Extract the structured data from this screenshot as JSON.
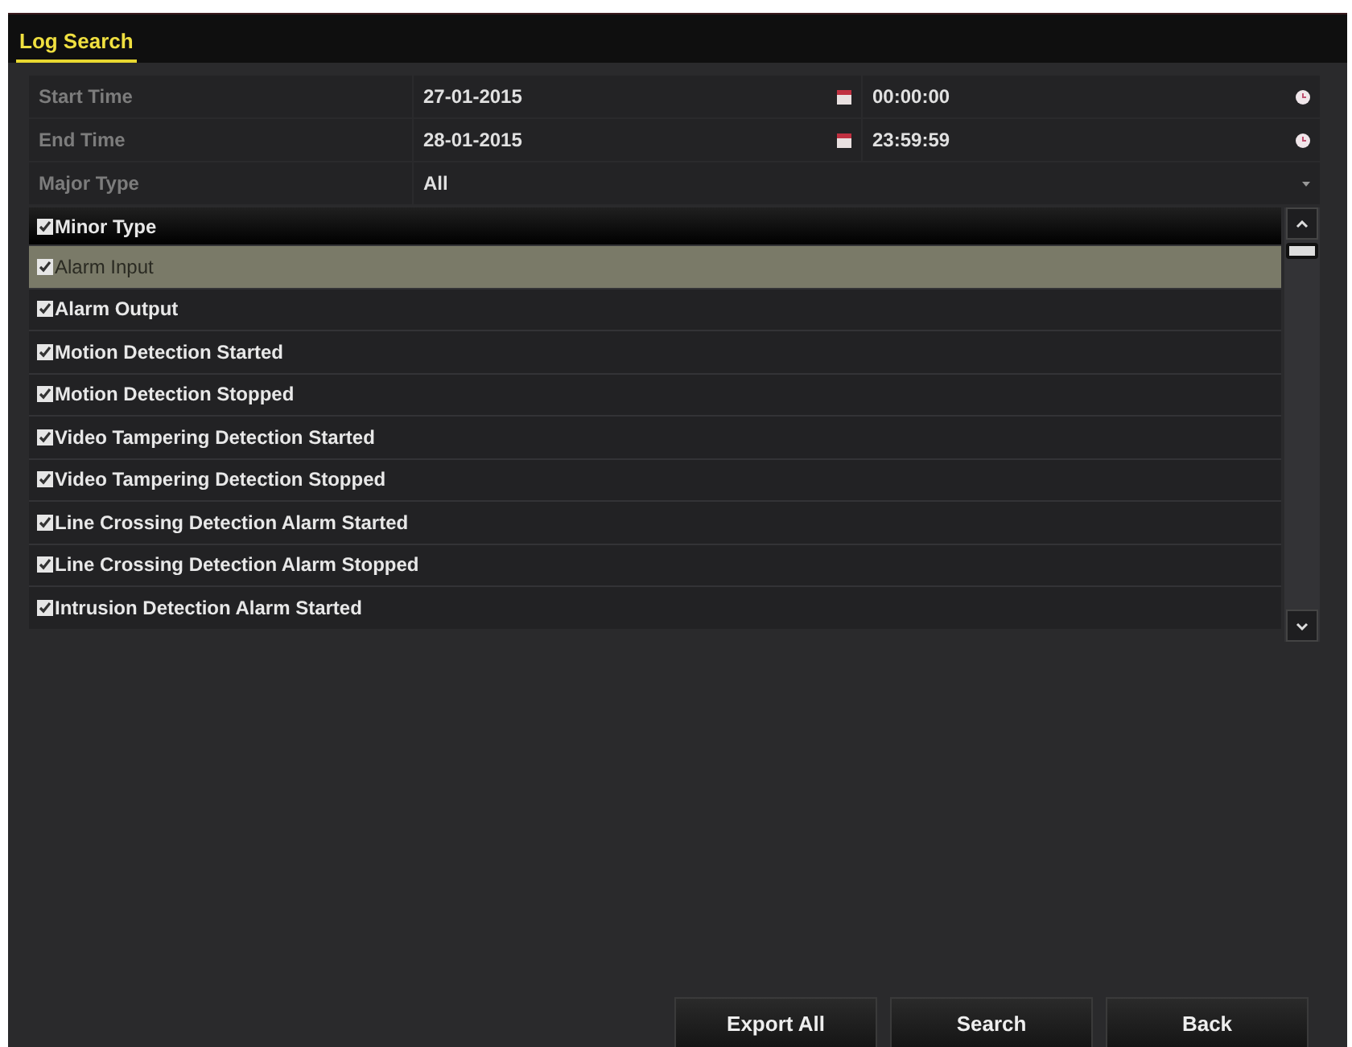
{
  "tabs": [
    {
      "label": "Log Search",
      "selected": true
    }
  ],
  "form": {
    "rows": [
      {
        "kind": "datetime",
        "label": "Start Time",
        "date": "27-01-2015",
        "time": "00:00:00"
      },
      {
        "kind": "datetime",
        "label": "End Time",
        "date": "28-01-2015",
        "time": "23:59:59"
      },
      {
        "kind": "select",
        "label": "Major Type",
        "value": "All"
      }
    ]
  },
  "minor_type": {
    "label": "Minor Type",
    "checked": true,
    "items": [
      {
        "label": "Alarm Input",
        "checked": true,
        "selected": true
      },
      {
        "label": "Alarm Output",
        "checked": true,
        "selected": false
      },
      {
        "label": "Motion Detection Started",
        "checked": true,
        "selected": false
      },
      {
        "label": "Motion Detection Stopped",
        "checked": true,
        "selected": false
      },
      {
        "label": "Video Tampering Detection Started",
        "checked": true,
        "selected": false
      },
      {
        "label": "Video Tampering Detection Stopped",
        "checked": true,
        "selected": false
      },
      {
        "label": "Line Crossing Detection Alarm Started",
        "checked": true,
        "selected": false
      },
      {
        "label": "Line Crossing Detection Alarm Stopped",
        "checked": true,
        "selected": false
      },
      {
        "label": "Intrusion Detection Alarm Started",
        "checked": true,
        "selected": false
      }
    ]
  },
  "buttons": [
    "Export All",
    "Search",
    "Back"
  ]
}
